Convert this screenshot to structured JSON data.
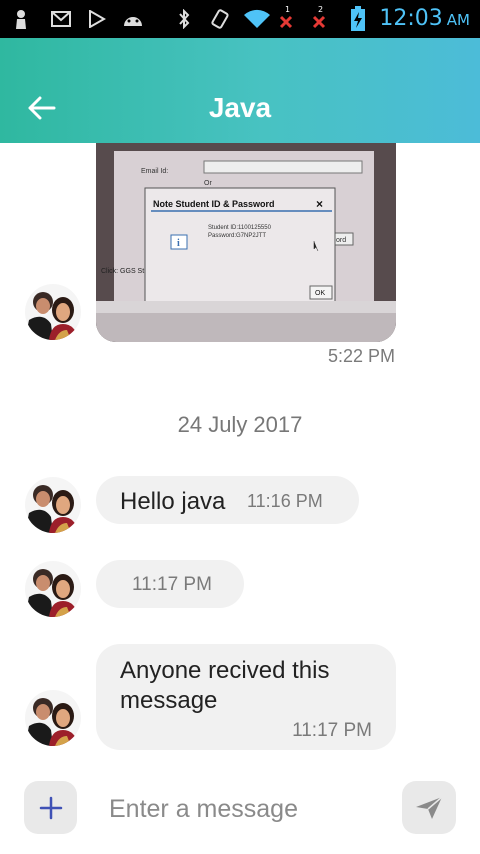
{
  "status_bar": {
    "time": "12:03",
    "ampm": "AM",
    "icons": [
      "person-icon",
      "mail-icon",
      "play-store-icon",
      "android-icon",
      "bluetooth-icon",
      "vibrate-icon",
      "wifi-icon",
      "sim1-no-signal-icon",
      "sim2-no-signal-icon",
      "battery-charging-icon"
    ],
    "sim1_label": "1",
    "sim2_label": "2"
  },
  "header": {
    "title": "Java",
    "background": "#3dbdb3"
  },
  "messages": [
    {
      "type": "image",
      "time": "5:22 PM",
      "image_text": {
        "dialog_title": "Note Student ID & Password",
        "close": "×",
        "line1": "Student ID:1100125550",
        "line2": "Password:G7NP2JTT",
        "ok": "OK",
        "bg_email": "Email Id:",
        "bg_or": "Or",
        "bg_click": "Click: GGS Stu",
        "bg_word": "ord"
      }
    },
    {
      "type": "date",
      "text": "24 July 2017"
    },
    {
      "type": "text",
      "text": "Hello java",
      "time": "11:16 PM"
    },
    {
      "type": "text",
      "text": "",
      "time": "11:17 PM"
    },
    {
      "type": "text",
      "text": "Anyone recived this message",
      "time": "11:17 PM"
    }
  ],
  "composer": {
    "placeholder": "Enter a message",
    "plus_icon": "plus-icon",
    "send_icon": "send-icon"
  },
  "colors": {
    "accent": "#3f51b5",
    "bubble": "#f1f1f1"
  }
}
